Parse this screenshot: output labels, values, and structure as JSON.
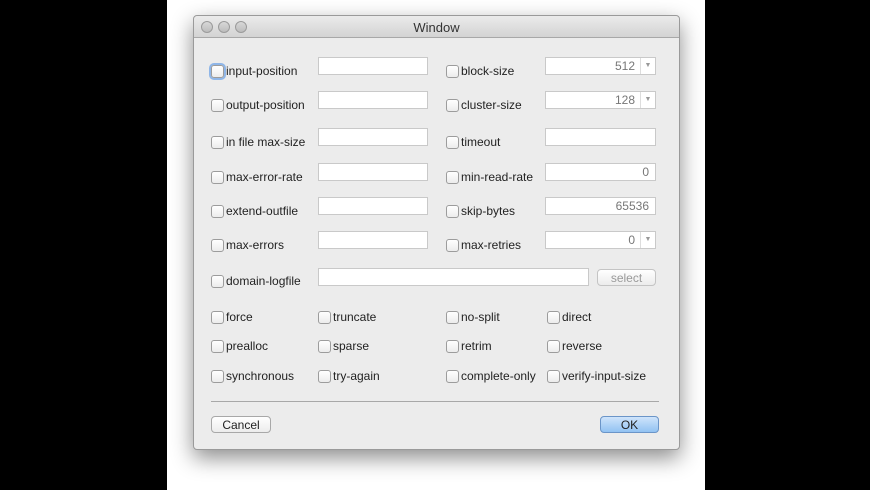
{
  "window": {
    "title": "Window"
  },
  "left_fields": [
    {
      "label": "input-position",
      "value": ""
    },
    {
      "label": "output-position",
      "value": ""
    },
    {
      "label": "in file max-size",
      "value": ""
    },
    {
      "label": "max-error-rate",
      "value": ""
    },
    {
      "label": "extend-outfile",
      "value": ""
    },
    {
      "label": "max-errors",
      "value": ""
    }
  ],
  "right_fields": [
    {
      "label": "block-size",
      "value": "512",
      "dropdown": true
    },
    {
      "label": "cluster-size",
      "value": "128",
      "dropdown": true
    },
    {
      "label": "timeout",
      "value": ""
    },
    {
      "label": "min-read-rate",
      "value": "0"
    },
    {
      "label": "skip-bytes",
      "value": "65536"
    },
    {
      "label": "max-retries",
      "value": "0",
      "dropdown": true
    }
  ],
  "domain_logfile": {
    "label": "domain-logfile",
    "value": "",
    "select_label": "select"
  },
  "options": [
    [
      "force",
      "truncate",
      "no-split",
      "direct"
    ],
    [
      "prealloc",
      "sparse",
      "retrim",
      "reverse"
    ],
    [
      "synchronous",
      "try-again",
      "complete-only",
      "verify-input-size"
    ]
  ],
  "buttons": {
    "cancel": "Cancel",
    "ok": "OK"
  }
}
